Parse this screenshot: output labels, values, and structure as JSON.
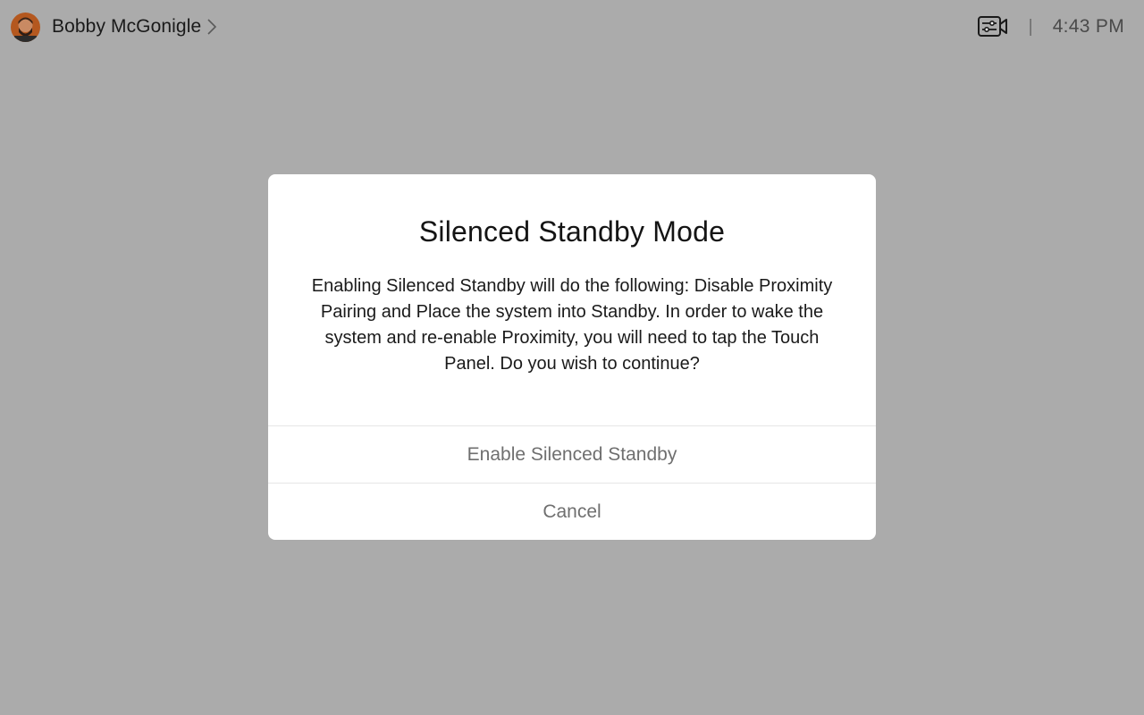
{
  "header": {
    "user_name": "Bobby McGonigle",
    "avatar_icon": "user-avatar",
    "chevron_icon": "chevron-right-icon",
    "camera_icon": "camera-controls-icon",
    "divider": "|",
    "time": "4:43 PM"
  },
  "dialog": {
    "title": "Silenced Standby Mode",
    "message": "Enabling Silenced Standby will do the following: Disable Proximity Pairing and Place the system into Standby. In order to wake the system and re-enable Proximity, you will need to tap the Touch Panel. Do you wish to continue?",
    "primary_label": "Enable Silenced Standby",
    "cancel_label": "Cancel"
  },
  "colors": {
    "backdrop": "#ababab",
    "dialog_bg": "#ffffff",
    "action_text": "#6f6f6f"
  }
}
